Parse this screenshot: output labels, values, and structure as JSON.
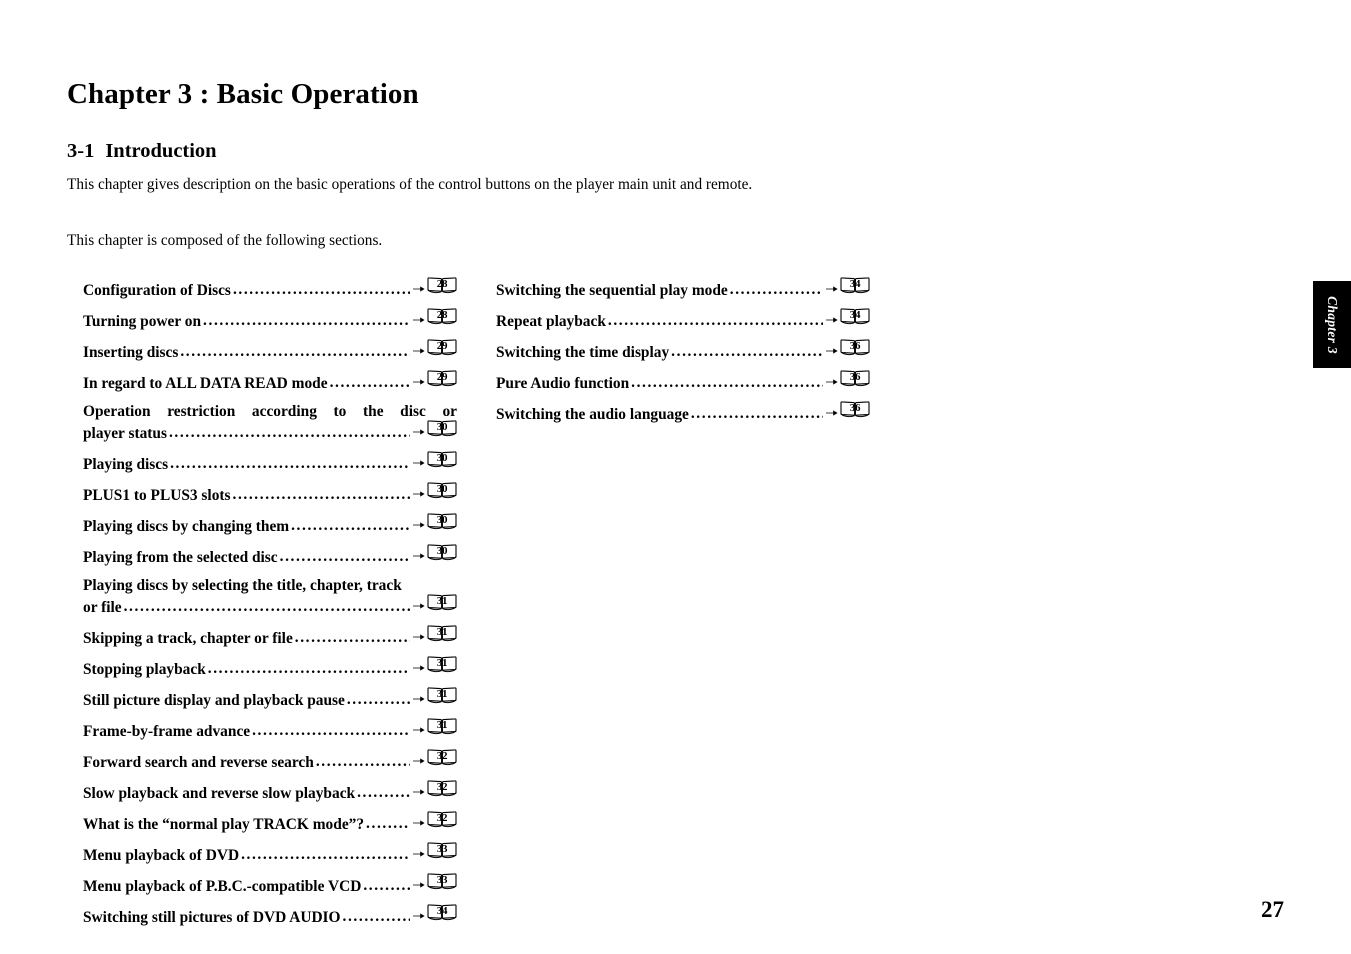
{
  "document": {
    "chapter_title": "Chapter 3 : Basic Operation",
    "section_number": "3-1",
    "section_title": "Introduction",
    "intro_paragraph_1": "This chapter gives description on the basic operations of the control buttons on the player main unit and remote.",
    "intro_paragraph_2": "This chapter is composed of the following sections.",
    "page_number": "27",
    "side_tab_label": "Chapter 3"
  },
  "icons": {
    "arrow": "right-arrow-icon",
    "page_marker": "open-book-icon"
  },
  "toc": {
    "left_column": [
      {
        "title": "Configuration of Discs",
        "page": "28",
        "wrapped": false
      },
      {
        "title": "Turning power on",
        "page": "28",
        "wrapped": false
      },
      {
        "title": "Inserting discs",
        "page": "29",
        "wrapped": false
      },
      {
        "title": "In regard to ALL DATA READ mode",
        "page": "29",
        "wrapped": false
      },
      {
        "title": "Operation restriction according to the disc or player status",
        "line1": "Operation restriction according to the disc or",
        "line2": "player status",
        "page": "30",
        "wrapped": true,
        "justified": true
      },
      {
        "title": "Playing discs",
        "page": "30",
        "wrapped": false
      },
      {
        "title": "PLUS1 to PLUS3 slots",
        "page": "30",
        "wrapped": false
      },
      {
        "title": "Playing discs by changing them",
        "page": "30",
        "wrapped": false
      },
      {
        "title": "Playing from the selected disc",
        "page": "30",
        "wrapped": false
      },
      {
        "title": "Playing discs by selecting the title, chapter, track or file",
        "line1": "Playing discs by selecting the title, chapter, track",
        "line2": "or file",
        "page": "31",
        "wrapped": true,
        "justified": false
      },
      {
        "title": "Skipping a track, chapter or file",
        "page": "31",
        "wrapped": false
      },
      {
        "title": "Stopping playback",
        "page": "31",
        "wrapped": false
      },
      {
        "title": "Still picture display and playback pause",
        "page": "31",
        "wrapped": false
      },
      {
        "title": "Frame-by-frame advance",
        "page": "31",
        "wrapped": false
      },
      {
        "title": "Forward search and reverse search",
        "page": "32",
        "wrapped": false
      },
      {
        "title": "Slow playback and reverse slow playback",
        "page": "32",
        "wrapped": false
      },
      {
        "title": "What is the “normal play TRACK mode”?",
        "page": "32",
        "wrapped": false
      },
      {
        "title": "Menu playback of DVD",
        "page": "33",
        "wrapped": false
      },
      {
        "title": "Menu playback of P.B.C.-compatible VCD",
        "page": "33",
        "wrapped": false
      },
      {
        "title": "Switching still pictures of DVD AUDIO",
        "page": "34",
        "wrapped": false
      }
    ],
    "right_column": [
      {
        "title": "Switching the sequential play mode",
        "page": "34",
        "wrapped": false
      },
      {
        "title": "Repeat playback",
        "page": "34",
        "wrapped": false
      },
      {
        "title": "Switching the time display",
        "page": "36",
        "wrapped": false
      },
      {
        "title": "Pure Audio function",
        "page": "36",
        "wrapped": false
      },
      {
        "title": "Switching the audio language",
        "page": "36",
        "wrapped": false
      }
    ]
  },
  "colors": {
    "page_background": "#ffffff",
    "text": "#000000",
    "tab_background": "#000000",
    "tab_text": "#ffffff"
  }
}
